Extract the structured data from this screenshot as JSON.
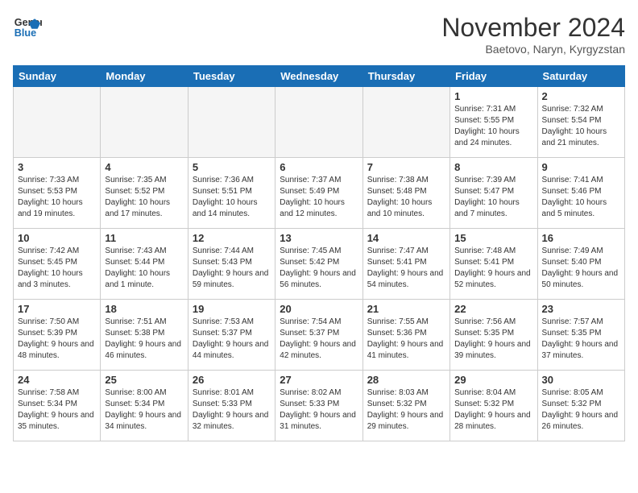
{
  "logo": {
    "line1": "General",
    "line2": "Blue"
  },
  "title": "November 2024",
  "subtitle": "Baetovo, Naryn, Kyrgyzstan",
  "weekdays": [
    "Sunday",
    "Monday",
    "Tuesday",
    "Wednesday",
    "Thursday",
    "Friday",
    "Saturday"
  ],
  "weeks": [
    [
      {
        "day": "",
        "sunrise": "",
        "sunset": "",
        "daylight": "",
        "empty": true
      },
      {
        "day": "",
        "sunrise": "",
        "sunset": "",
        "daylight": "",
        "empty": true
      },
      {
        "day": "",
        "sunrise": "",
        "sunset": "",
        "daylight": "",
        "empty": true
      },
      {
        "day": "",
        "sunrise": "",
        "sunset": "",
        "daylight": "",
        "empty": true
      },
      {
        "day": "",
        "sunrise": "",
        "sunset": "",
        "daylight": "",
        "empty": true
      },
      {
        "day": "1",
        "sunrise": "Sunrise: 7:31 AM",
        "sunset": "Sunset: 5:55 PM",
        "daylight": "Daylight: 10 hours and 24 minutes."
      },
      {
        "day": "2",
        "sunrise": "Sunrise: 7:32 AM",
        "sunset": "Sunset: 5:54 PM",
        "daylight": "Daylight: 10 hours and 21 minutes."
      }
    ],
    [
      {
        "day": "3",
        "sunrise": "Sunrise: 7:33 AM",
        "sunset": "Sunset: 5:53 PM",
        "daylight": "Daylight: 10 hours and 19 minutes."
      },
      {
        "day": "4",
        "sunrise": "Sunrise: 7:35 AM",
        "sunset": "Sunset: 5:52 PM",
        "daylight": "Daylight: 10 hours and 17 minutes."
      },
      {
        "day": "5",
        "sunrise": "Sunrise: 7:36 AM",
        "sunset": "Sunset: 5:51 PM",
        "daylight": "Daylight: 10 hours and 14 minutes."
      },
      {
        "day": "6",
        "sunrise": "Sunrise: 7:37 AM",
        "sunset": "Sunset: 5:49 PM",
        "daylight": "Daylight: 10 hours and 12 minutes."
      },
      {
        "day": "7",
        "sunrise": "Sunrise: 7:38 AM",
        "sunset": "Sunset: 5:48 PM",
        "daylight": "Daylight: 10 hours and 10 minutes."
      },
      {
        "day": "8",
        "sunrise": "Sunrise: 7:39 AM",
        "sunset": "Sunset: 5:47 PM",
        "daylight": "Daylight: 10 hours and 7 minutes."
      },
      {
        "day": "9",
        "sunrise": "Sunrise: 7:41 AM",
        "sunset": "Sunset: 5:46 PM",
        "daylight": "Daylight: 10 hours and 5 minutes."
      }
    ],
    [
      {
        "day": "10",
        "sunrise": "Sunrise: 7:42 AM",
        "sunset": "Sunset: 5:45 PM",
        "daylight": "Daylight: 10 hours and 3 minutes."
      },
      {
        "day": "11",
        "sunrise": "Sunrise: 7:43 AM",
        "sunset": "Sunset: 5:44 PM",
        "daylight": "Daylight: 10 hours and 1 minute."
      },
      {
        "day": "12",
        "sunrise": "Sunrise: 7:44 AM",
        "sunset": "Sunset: 5:43 PM",
        "daylight": "Daylight: 9 hours and 59 minutes."
      },
      {
        "day": "13",
        "sunrise": "Sunrise: 7:45 AM",
        "sunset": "Sunset: 5:42 PM",
        "daylight": "Daylight: 9 hours and 56 minutes."
      },
      {
        "day": "14",
        "sunrise": "Sunrise: 7:47 AM",
        "sunset": "Sunset: 5:41 PM",
        "daylight": "Daylight: 9 hours and 54 minutes."
      },
      {
        "day": "15",
        "sunrise": "Sunrise: 7:48 AM",
        "sunset": "Sunset: 5:41 PM",
        "daylight": "Daylight: 9 hours and 52 minutes."
      },
      {
        "day": "16",
        "sunrise": "Sunrise: 7:49 AM",
        "sunset": "Sunset: 5:40 PM",
        "daylight": "Daylight: 9 hours and 50 minutes."
      }
    ],
    [
      {
        "day": "17",
        "sunrise": "Sunrise: 7:50 AM",
        "sunset": "Sunset: 5:39 PM",
        "daylight": "Daylight: 9 hours and 48 minutes."
      },
      {
        "day": "18",
        "sunrise": "Sunrise: 7:51 AM",
        "sunset": "Sunset: 5:38 PM",
        "daylight": "Daylight: 9 hours and 46 minutes."
      },
      {
        "day": "19",
        "sunrise": "Sunrise: 7:53 AM",
        "sunset": "Sunset: 5:37 PM",
        "daylight": "Daylight: 9 hours and 44 minutes."
      },
      {
        "day": "20",
        "sunrise": "Sunrise: 7:54 AM",
        "sunset": "Sunset: 5:37 PM",
        "daylight": "Daylight: 9 hours and 42 minutes."
      },
      {
        "day": "21",
        "sunrise": "Sunrise: 7:55 AM",
        "sunset": "Sunset: 5:36 PM",
        "daylight": "Daylight: 9 hours and 41 minutes."
      },
      {
        "day": "22",
        "sunrise": "Sunrise: 7:56 AM",
        "sunset": "Sunset: 5:35 PM",
        "daylight": "Daylight: 9 hours and 39 minutes."
      },
      {
        "day": "23",
        "sunrise": "Sunrise: 7:57 AM",
        "sunset": "Sunset: 5:35 PM",
        "daylight": "Daylight: 9 hours and 37 minutes."
      }
    ],
    [
      {
        "day": "24",
        "sunrise": "Sunrise: 7:58 AM",
        "sunset": "Sunset: 5:34 PM",
        "daylight": "Daylight: 9 hours and 35 minutes."
      },
      {
        "day": "25",
        "sunrise": "Sunrise: 8:00 AM",
        "sunset": "Sunset: 5:34 PM",
        "daylight": "Daylight: 9 hours and 34 minutes."
      },
      {
        "day": "26",
        "sunrise": "Sunrise: 8:01 AM",
        "sunset": "Sunset: 5:33 PM",
        "daylight": "Daylight: 9 hours and 32 minutes."
      },
      {
        "day": "27",
        "sunrise": "Sunrise: 8:02 AM",
        "sunset": "Sunset: 5:33 PM",
        "daylight": "Daylight: 9 hours and 31 minutes."
      },
      {
        "day": "28",
        "sunrise": "Sunrise: 8:03 AM",
        "sunset": "Sunset: 5:32 PM",
        "daylight": "Daylight: 9 hours and 29 minutes."
      },
      {
        "day": "29",
        "sunrise": "Sunrise: 8:04 AM",
        "sunset": "Sunset: 5:32 PM",
        "daylight": "Daylight: 9 hours and 28 minutes."
      },
      {
        "day": "30",
        "sunrise": "Sunrise: 8:05 AM",
        "sunset": "Sunset: 5:32 PM",
        "daylight": "Daylight: 9 hours and 26 minutes."
      }
    ]
  ]
}
